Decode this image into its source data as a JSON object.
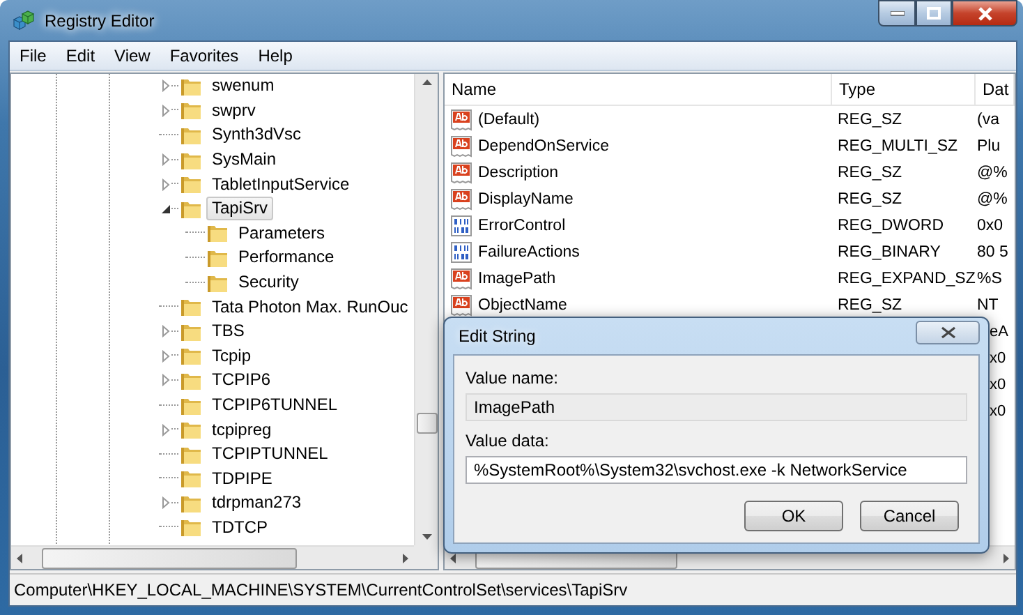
{
  "window": {
    "title": "Registry Editor"
  },
  "menu": [
    "File",
    "Edit",
    "View",
    "Favorites",
    "Help"
  ],
  "tree": [
    {
      "label": "swenum",
      "kind": "branch",
      "expanded": false,
      "selected": false
    },
    {
      "label": "swprv",
      "kind": "branch",
      "expanded": false,
      "selected": false
    },
    {
      "label": "Synth3dVsc",
      "kind": "leaf",
      "selected": false
    },
    {
      "label": "SysMain",
      "kind": "branch",
      "expanded": false,
      "selected": false
    },
    {
      "label": "TabletInputService",
      "kind": "branch",
      "expanded": false,
      "selected": false
    },
    {
      "label": "TapiSrv",
      "kind": "branch",
      "expanded": true,
      "selected": true,
      "children": [
        {
          "label": "Parameters",
          "kind": "leaf",
          "selected": false
        },
        {
          "label": "Performance",
          "kind": "leaf",
          "selected": false
        },
        {
          "label": "Security",
          "kind": "leaf",
          "selected": false
        }
      ]
    },
    {
      "label": "Tata Photon Max. RunOuc",
      "kind": "leaf",
      "selected": false
    },
    {
      "label": "TBS",
      "kind": "branch",
      "expanded": false,
      "selected": false
    },
    {
      "label": "Tcpip",
      "kind": "branch",
      "expanded": false,
      "selected": false
    },
    {
      "label": "TCPIP6",
      "kind": "branch",
      "expanded": false,
      "selected": false
    },
    {
      "label": "TCPIP6TUNNEL",
      "kind": "leaf",
      "selected": false
    },
    {
      "label": "tcpipreg",
      "kind": "branch",
      "expanded": false,
      "selected": false
    },
    {
      "label": "TCPIPTUNNEL",
      "kind": "leaf",
      "selected": false
    },
    {
      "label": "TDPIPE",
      "kind": "leaf",
      "selected": false
    },
    {
      "label": "tdrpman273",
      "kind": "branch",
      "expanded": false,
      "selected": false
    },
    {
      "label": "TDTCP",
      "kind": "leaf",
      "selected": false
    }
  ],
  "table": {
    "columns": [
      "Name",
      "Type",
      "Dat"
    ],
    "rows": [
      {
        "kind": "string",
        "name": "(Default)",
        "type": "REG_SZ",
        "data": "(va"
      },
      {
        "kind": "string",
        "name": "DependOnService",
        "type": "REG_MULTI_SZ",
        "data": "Plu"
      },
      {
        "kind": "string",
        "name": "Description",
        "type": "REG_SZ",
        "data": "@%"
      },
      {
        "kind": "string",
        "name": "DisplayName",
        "type": "REG_SZ",
        "data": "@%"
      },
      {
        "kind": "binary",
        "name": "ErrorControl",
        "type": "REG_DWORD",
        "data": "0x0"
      },
      {
        "kind": "binary",
        "name": "FailureActions",
        "type": "REG_BINARY",
        "data": "80 5"
      },
      {
        "kind": "string",
        "name": "ImagePath",
        "type": "REG_EXPAND_SZ",
        "data": "%S"
      },
      {
        "kind": "string",
        "name": "ObjectName",
        "type": "REG_SZ",
        "data": "NT"
      },
      {
        "kind": "hidden",
        "data": "eA"
      },
      {
        "kind": "hidden",
        "data": "x0"
      },
      {
        "kind": "hidden",
        "data": "x0"
      },
      {
        "kind": "hidden",
        "data": "x0"
      }
    ]
  },
  "dialog": {
    "title": "Edit String",
    "fields": [
      {
        "label": "Value name:",
        "value": "ImagePath",
        "read_only": true
      },
      {
        "label": "Value data:",
        "value": "%SystemRoot%\\System32\\svchost.exe -k NetworkService",
        "read_only": false
      }
    ],
    "buttons": [
      "OK",
      "Cancel"
    ]
  },
  "status_bar": "Computer\\HKEY_LOCAL_MACHINE\\SYSTEM\\CurrentControlSet\\services\\TapiSrv"
}
